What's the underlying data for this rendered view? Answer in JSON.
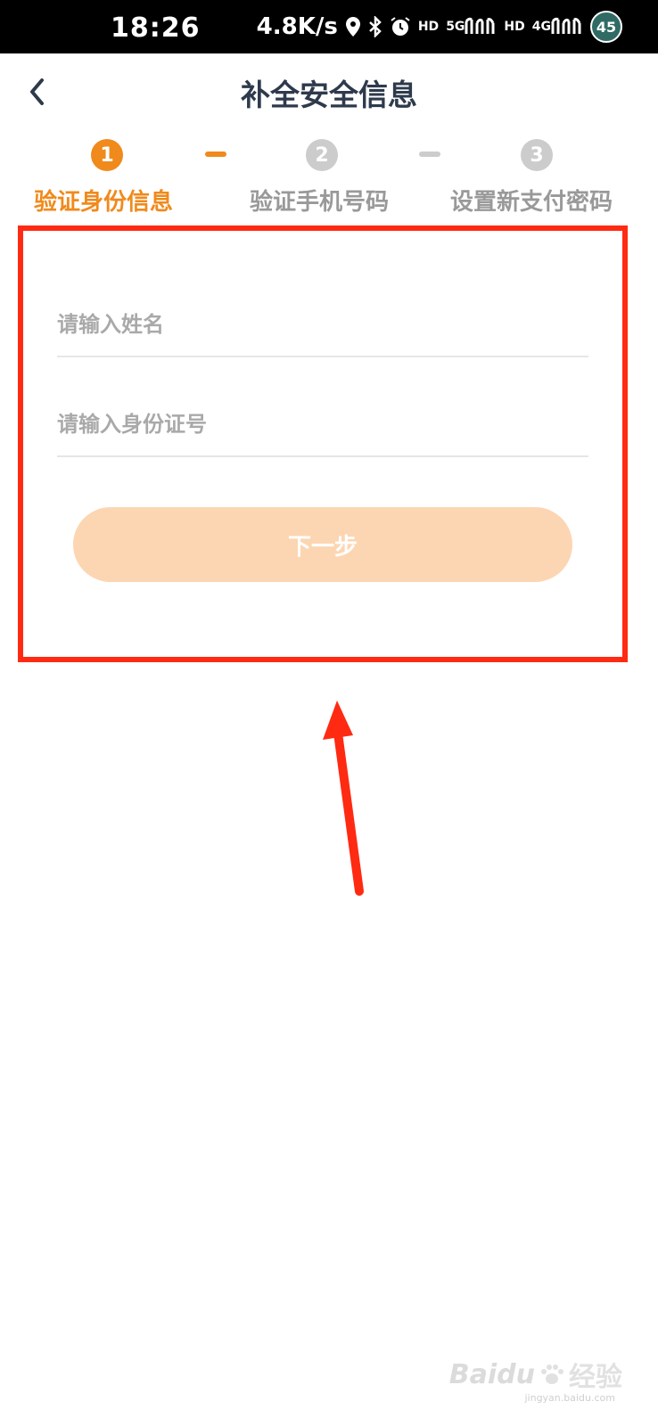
{
  "status_bar": {
    "time": "18:26",
    "net_speed": "4.8K/s",
    "sim1_type": "5G",
    "sim2_type": "4G",
    "battery": "45"
  },
  "header": {
    "back_icon": "chevron-left-icon",
    "title": "补全安全信息"
  },
  "steps": [
    {
      "number": "1",
      "label": "验证身份信息",
      "active": true
    },
    {
      "number": "2",
      "label": "验证手机号码",
      "active": false
    },
    {
      "number": "3",
      "label": "设置新支付密码",
      "active": false
    }
  ],
  "form": {
    "name_placeholder": "请输入姓名",
    "name_value": "",
    "id_placeholder": "请输入身份证号",
    "id_value": "",
    "next_label": "下一步"
  },
  "colors": {
    "accent": "#f08a1c",
    "inactive": "#cccccc",
    "button_disabled": "#fcd6b2",
    "annotation": "#ff2a12"
  },
  "watermark": {
    "brand": "Baidu",
    "brand_cn": "经验",
    "url": "jingyan.baidu.com"
  }
}
